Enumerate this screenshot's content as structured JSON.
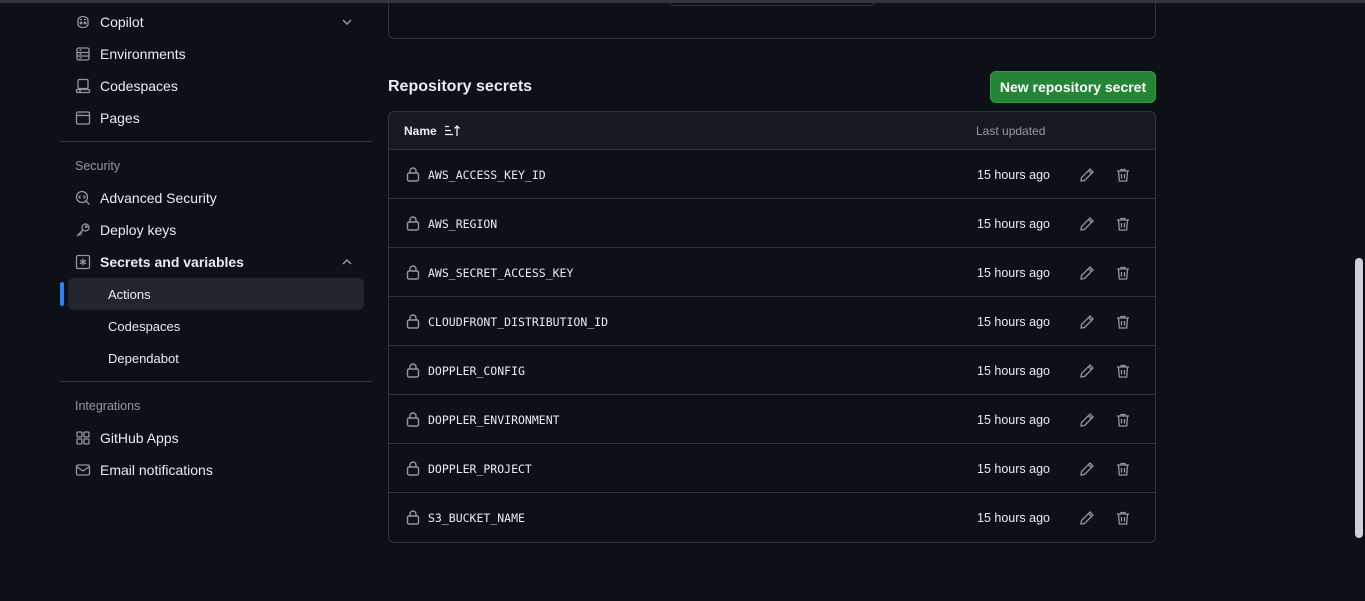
{
  "sidebar": {
    "items_top": [
      {
        "label": "Copilot",
        "icon": "copilot-icon",
        "has_chevron": true
      },
      {
        "label": "Environments",
        "icon": "server-icon"
      },
      {
        "label": "Codespaces",
        "icon": "codespaces-icon"
      },
      {
        "label": "Pages",
        "icon": "browser-icon"
      }
    ],
    "security_heading": "Security",
    "security_items": [
      {
        "label": "Advanced Security",
        "icon": "codescan-icon"
      },
      {
        "label": "Deploy keys",
        "icon": "key-icon"
      },
      {
        "label": "Secrets and variables",
        "icon": "key-asterisk-icon"
      }
    ],
    "secrets_subitems": [
      {
        "label": "Actions",
        "active": true
      },
      {
        "label": "Codespaces"
      },
      {
        "label": "Dependabot"
      }
    ],
    "integrations_heading": "Integrations",
    "integrations_items": [
      {
        "label": "GitHub Apps",
        "icon": "apps-icon"
      },
      {
        "label": "Email notifications",
        "icon": "mail-icon"
      }
    ]
  },
  "secrets": {
    "title": "Repository secrets",
    "new_button_label": "New repository secret",
    "columns": {
      "name": "Name",
      "updated": "Last updated"
    },
    "rows": [
      {
        "name": "AWS_ACCESS_KEY_ID",
        "updated": "15 hours ago"
      },
      {
        "name": "AWS_REGION",
        "updated": "15 hours ago"
      },
      {
        "name": "AWS_SECRET_ACCESS_KEY",
        "updated": "15 hours ago"
      },
      {
        "name": "CLOUDFRONT_DISTRIBUTION_ID",
        "updated": "15 hours ago"
      },
      {
        "name": "DOPPLER_CONFIG",
        "updated": "15 hours ago"
      },
      {
        "name": "DOPPLER_ENVIRONMENT",
        "updated": "15 hours ago"
      },
      {
        "name": "DOPPLER_PROJECT",
        "updated": "15 hours ago"
      },
      {
        "name": "S3_BUCKET_NAME",
        "updated": "15 hours ago"
      }
    ]
  },
  "colors": {
    "background": "#0d1117",
    "border": "#30363d",
    "primary_button": "#238636",
    "active_indicator": "#2f81f7",
    "muted_text": "#9198a1"
  }
}
